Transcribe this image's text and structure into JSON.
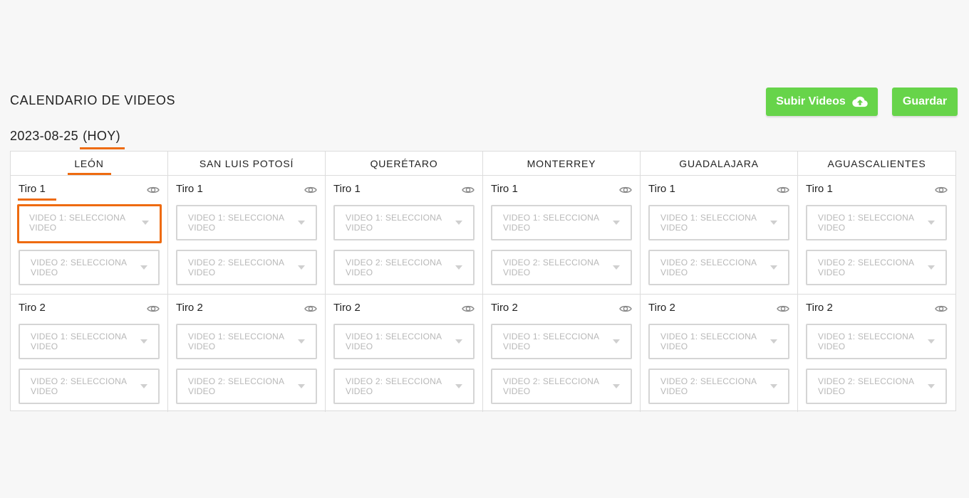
{
  "header": {
    "title": "CALENDARIO DE VIDEOS",
    "upload_label": "Subir Videos",
    "upload_icon": "cloud-upload-icon",
    "save_label": "Guardar",
    "accent_color": "#67d44a",
    "highlight_color": "#ee6b10"
  },
  "date": {
    "value": "2023-08-25",
    "today_label": "(HOY)"
  },
  "cities": [
    {
      "name": "LEÓN",
      "active": true
    },
    {
      "name": "SAN LUIS POTOSÍ"
    },
    {
      "name": "QUERÉTARO"
    },
    {
      "name": "MONTERREY"
    },
    {
      "name": "GUADALAJARA"
    },
    {
      "name": "AGUASCALIENTES"
    }
  ],
  "shots": [
    "Tiro 1",
    "Tiro 2"
  ],
  "selects": {
    "video1_placeholder": "VIDEO 1: SELECCIONA VIDEO",
    "video2_placeholder": "VIDEO 2: SELECCIONA VIDEO"
  }
}
